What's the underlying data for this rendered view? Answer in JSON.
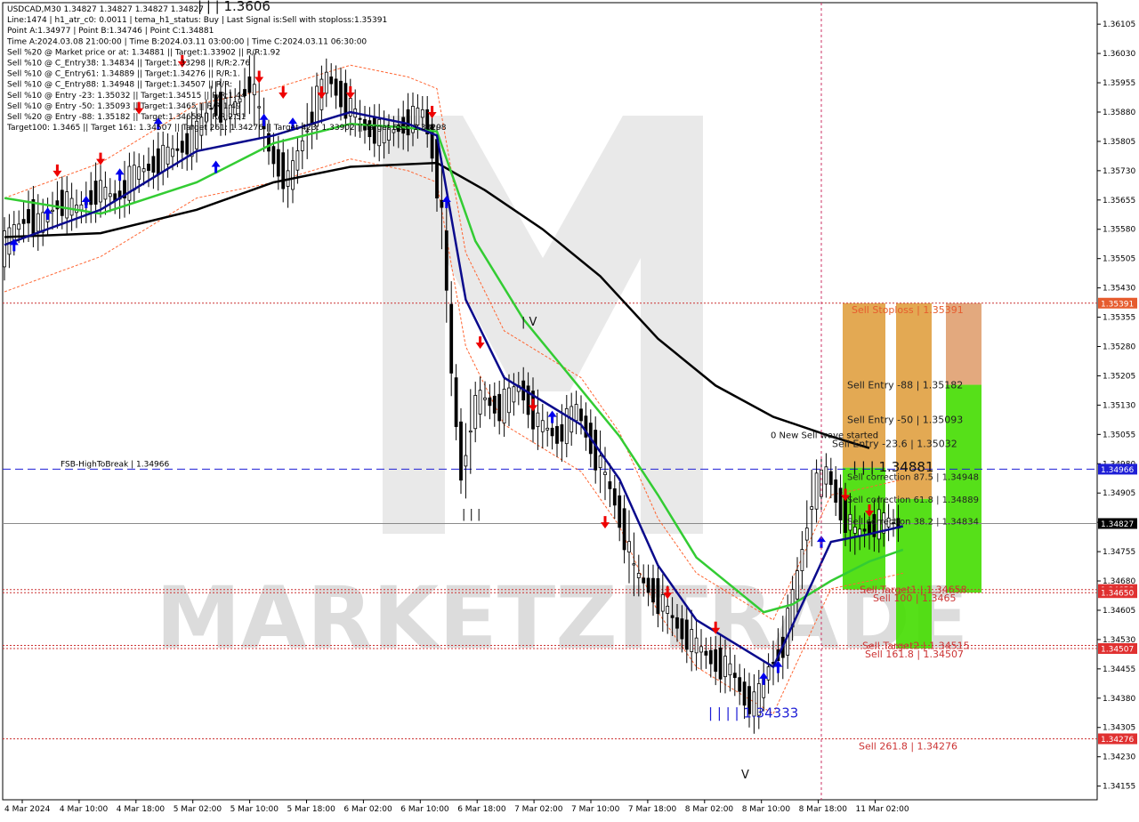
{
  "header": {
    "lines": [
      "USDCAD,M30   1.34827 1.34827 1.34827 1.34827",
      "Line:1474 | h1_atr_c0: 0.0011 | tema_h1_status: Buy | Last Signal is:Sell with stoploss:1.35391",
      "Point A:1.34977 | Point B:1.34746 | Point C:1.34881",
      "Time A:2024.03.08 21:00:00 | Time B:2024.03.11 03:00:00 | Time C:2024.03.11 06:30:00",
      "Sell %20 @ Market price or at: 1.34881 || Target:1.33902 || R/R:1.92",
      "Sell %10 @ C_Entry38: 1.34834 || Target:1.33298 || R/R:2.76",
      "Sell %10 @ C_Entry61: 1.34889 || Target:1.34276 || R/R:1.",
      "Sell %10 @ C_Entry88: 1.34948 || Target:1.34507 || R/R:",
      "Sell %10 @ Entry -23: 1.35032 || Target:1.34515 || R/R:1.44",
      "Sell %10 @ Entry -50: 1.35093 || Target:1.3465 || R/R:1.49",
      "Sell %20 @ Entry -88: 1.35182 || Target:1.34658 || R/R:2.51",
      "Target100: 1.3465 || Target 161: 1.34507 || Target 261: 1.34276 || Target 423: 1.33902 || Target 685: 1.33298"
    ]
  },
  "colors": {
    "ema_fast": "#0a0a8c",
    "ema_mid": "#33cc33",
    "ema_slow": "#000000",
    "envelope": "#ff6633",
    "stoploss": "#cc3333",
    "fsb": "#1f1fd6",
    "sell_arrow": "#ee0000",
    "buy_arrow": "#0000ee",
    "zone_orange": "#e0a040",
    "zone_green": "#44dd00",
    "watermark": "#dddddd"
  },
  "labels": {
    "wave_label": "0 New Sell wave started",
    "fsb": "FSB-HighToBreak | 1.34966",
    "stoploss": "Sell Stoploss | 1.35391",
    "entry88": "Sell Entry -88 | 1.35182",
    "entry50": "Sell Entry -50 | 1.35093",
    "entry23": "Sell Entry -23.6 | 1.35032",
    "point_c": "| | | 1.34881",
    "corr875": "Sell correction 87.5 | 1.34948",
    "corr618": "Sell correction 61.8 | 1.34889",
    "corr382": "Sell correction 38.2 | 1.34834",
    "target100": "Sell Target1 | 1.34658",
    "t100": "Sell 100 | 1.3465",
    "target2": "Sell Target2 | 1.34515",
    "t161": "Sell 161.8 | 1.34507",
    "t261": "Sell 261.8 | 1.34276",
    "low_label": "| | | | 1.34333",
    "high_label": "| | | 1.3606",
    "wave_iv": "| V",
    "wave_iii": "| | |",
    "wave_v": "V",
    "watermark": "MARKETZITRADE"
  },
  "chart_data": {
    "type": "line",
    "symbol": "USDCAD",
    "timeframe": "M30",
    "ylim": [
      1.3412,
      1.3616
    ],
    "y_ticks": [
      "1.36105",
      "1.36030",
      "1.35955",
      "1.35880",
      "1.35805",
      "1.35730",
      "1.35655",
      "1.35580",
      "1.35505",
      "1.35430",
      "1.35355",
      "1.35280",
      "1.35205",
      "1.35130",
      "1.35055",
      "1.34980",
      "1.34905",
      "1.34830",
      "1.34755",
      "1.34680",
      "1.34605",
      "1.34530",
      "1.34455",
      "1.34380",
      "1.34305",
      "1.34230",
      "1.34155"
    ],
    "x_ticks": [
      "4 Mar 2024",
      "4 Mar 10:00",
      "4 Mar 18:00",
      "5 Mar 02:00",
      "5 Mar 10:00",
      "5 Mar 18:00",
      "6 Mar 02:00",
      "6 Mar 10:00",
      "6 Mar 18:00",
      "7 Mar 02:00",
      "7 Mar 10:00",
      "7 Mar 18:00",
      "8 Mar 02:00",
      "8 Mar 10:00",
      "8 Mar 18:00",
      "11 Mar 02:00"
    ],
    "price_tags": [
      {
        "value": "1.35391",
        "price": 1.35391,
        "color": "#e65c2e"
      },
      {
        "value": "1.34966",
        "price": 1.34966,
        "color": "#1f1fd6"
      },
      {
        "value": "1.34827",
        "price": 1.34827,
        "color": "#000000"
      },
      {
        "value": "1.34658",
        "price": 1.34658,
        "color": "#e03030"
      },
      {
        "value": "1.34650",
        "price": 1.3465,
        "color": "#e03030"
      },
      {
        "value": "1.34507",
        "price": 1.34507,
        "color": "#e03030"
      },
      {
        "value": "1.34276",
        "price": 1.34276,
        "color": "#e03030"
      }
    ],
    "last_price": 1.34827,
    "levels": {
      "stoploss": 1.35391,
      "fsb": 1.34966,
      "target1": 1.34658,
      "t100": 1.3465,
      "target2": 1.34515,
      "t161": 1.34507,
      "t261": 1.34276
    },
    "price_path": [
      [
        0,
        1.3552
      ],
      [
        3,
        1.3558
      ],
      [
        6,
        1.3562
      ],
      [
        8,
        1.3559
      ],
      [
        12,
        1.3565
      ],
      [
        16,
        1.3563
      ],
      [
        20,
        1.3568
      ],
      [
        24,
        1.3566
      ],
      [
        28,
        1.3572
      ],
      [
        32,
        1.3575
      ],
      [
        36,
        1.3578
      ],
      [
        40,
        1.3581
      ],
      [
        44,
        1.359
      ],
      [
        48,
        1.3588
      ],
      [
        52,
        1.3596
      ],
      [
        56,
        1.3578
      ],
      [
        60,
        1.357
      ],
      [
        64,
        1.3585
      ],
      [
        68,
        1.3597
      ],
      [
        72,
        1.359
      ],
      [
        76,
        1.3584
      ],
      [
        80,
        1.3582
      ],
      [
        84,
        1.3585
      ],
      [
        88,
        1.3588
      ],
      [
        90,
        1.3578
      ],
      [
        92,
        1.356
      ],
      [
        94,
        1.352
      ],
      [
        96,
        1.3495
      ],
      [
        98,
        1.351
      ],
      [
        100,
        1.3515
      ],
      [
        104,
        1.3512
      ],
      [
        108,
        1.3518
      ],
      [
        112,
        1.3508
      ],
      [
        116,
        1.3505
      ],
      [
        120,
        1.3512
      ],
      [
        124,
        1.35
      ],
      [
        128,
        1.3488
      ],
      [
        132,
        1.347
      ],
      [
        136,
        1.3465
      ],
      [
        140,
        1.3458
      ],
      [
        144,
        1.3452
      ],
      [
        148,
        1.3448
      ],
      [
        152,
        1.3445
      ],
      [
        155,
        1.3438
      ],
      [
        157,
        1.3436
      ],
      [
        160,
        1.3446
      ],
      [
        163,
        1.3452
      ],
      [
        166,
        1.347
      ],
      [
        169,
        1.349
      ],
      [
        172,
        1.3496
      ],
      [
        175,
        1.3486
      ],
      [
        178,
        1.348
      ],
      [
        181,
        1.3482
      ],
      [
        184,
        1.3483
      ],
      [
        187,
        1.34827
      ]
    ],
    "ema_fast": [
      [
        0,
        1.3554
      ],
      [
        20,
        1.3563
      ],
      [
        40,
        1.3578
      ],
      [
        56,
        1.3582
      ],
      [
        72,
        1.3588
      ],
      [
        84,
        1.3585
      ],
      [
        90,
        1.3582
      ],
      [
        96,
        1.354
      ],
      [
        104,
        1.352
      ],
      [
        112,
        1.3514
      ],
      [
        120,
        1.3508
      ],
      [
        128,
        1.3494
      ],
      [
        136,
        1.3472
      ],
      [
        144,
        1.3458
      ],
      [
        152,
        1.3452
      ],
      [
        160,
        1.3446
      ],
      [
        166,
        1.3462
      ],
      [
        172,
        1.3478
      ],
      [
        180,
        1.348
      ],
      [
        187,
        1.3482
      ]
    ],
    "ema_mid": [
      [
        0,
        1.3566
      ],
      [
        20,
        1.3562
      ],
      [
        40,
        1.357
      ],
      [
        56,
        1.358
      ],
      [
        72,
        1.3585
      ],
      [
        84,
        1.3584
      ],
      [
        90,
        1.3583
      ],
      [
        98,
        1.3555
      ],
      [
        108,
        1.3535
      ],
      [
        118,
        1.352
      ],
      [
        128,
        1.3505
      ],
      [
        136,
        1.349
      ],
      [
        144,
        1.3474
      ],
      [
        152,
        1.3466
      ],
      [
        158,
        1.346
      ],
      [
        164,
        1.3462
      ],
      [
        172,
        1.3468
      ],
      [
        180,
        1.3473
      ],
      [
        187,
        1.3476
      ]
    ],
    "ema_slow": [
      [
        0,
        1.3556
      ],
      [
        20,
        1.3557
      ],
      [
        40,
        1.3563
      ],
      [
        56,
        1.357
      ],
      [
        72,
        1.3574
      ],
      [
        90,
        1.3575
      ],
      [
        100,
        1.3568
      ],
      [
        112,
        1.3558
      ],
      [
        124,
        1.3546
      ],
      [
        136,
        1.353
      ],
      [
        148,
        1.3518
      ],
      [
        160,
        1.351
      ],
      [
        172,
        1.3505
      ],
      [
        180,
        1.3502
      ]
    ],
    "sell_arrows": [
      [
        11,
        1.3573
      ],
      [
        20,
        1.3576
      ],
      [
        28,
        1.3589
      ],
      [
        37,
        1.3601
      ],
      [
        53,
        1.3597
      ],
      [
        58,
        1.3593
      ],
      [
        66,
        1.3593
      ],
      [
        72,
        1.3593
      ],
      [
        89,
        1.3588
      ],
      [
        99,
        1.3529
      ],
      [
        110,
        1.3513
      ],
      [
        125,
        1.3483
      ],
      [
        138,
        1.3465
      ],
      [
        148,
        1.3456
      ],
      [
        175,
        1.349
      ],
      [
        180,
        1.3486
      ]
    ],
    "buy_arrows": [
      [
        2,
        1.3554
      ],
      [
        9,
        1.3562
      ],
      [
        17,
        1.3565
      ],
      [
        24,
        1.3572
      ],
      [
        32,
        1.3585
      ],
      [
        44,
        1.3574
      ],
      [
        54,
        1.3586
      ],
      [
        60,
        1.3585
      ],
      [
        92,
        1.3565
      ],
      [
        114,
        1.351
      ],
      [
        158,
        1.3443
      ],
      [
        161,
        1.3446
      ],
      [
        170,
        1.3478
      ]
    ]
  }
}
